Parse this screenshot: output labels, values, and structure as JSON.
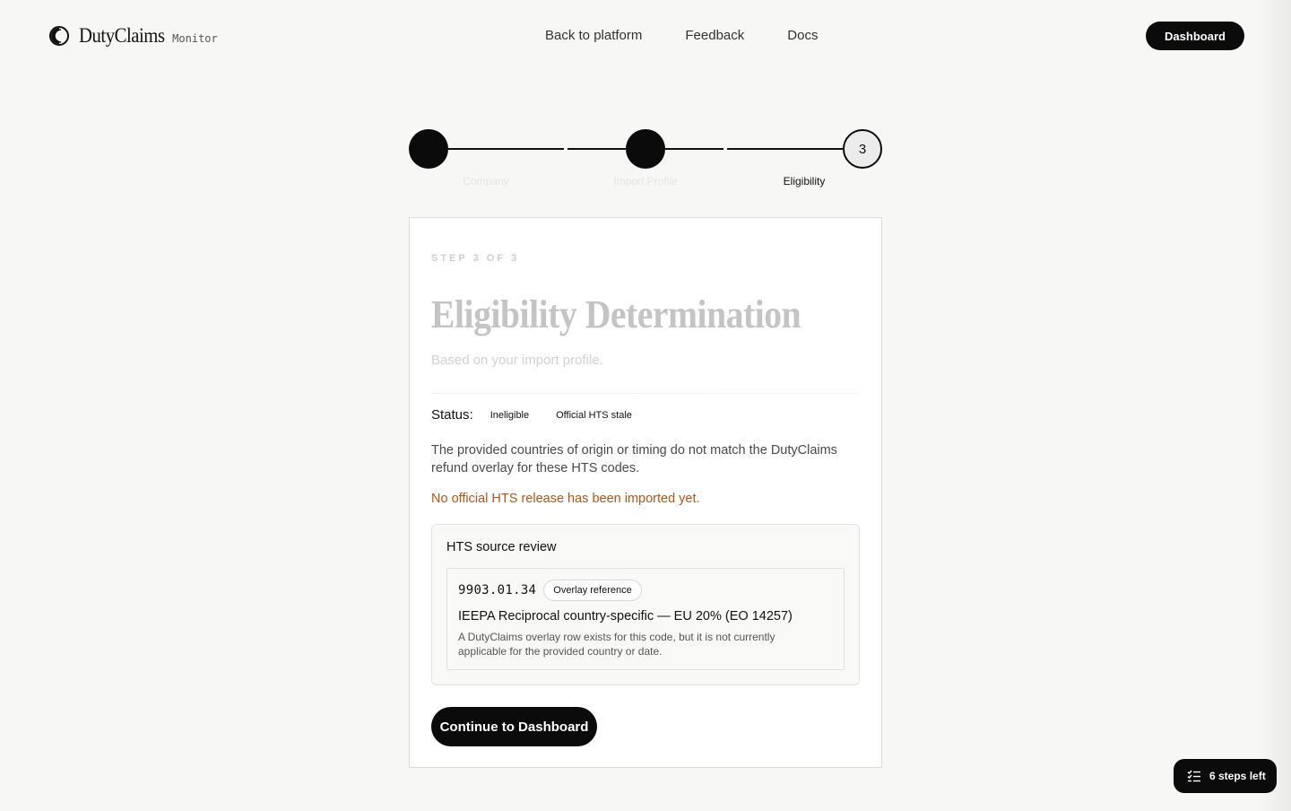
{
  "header": {
    "brand_name": "DutyClaims",
    "brand_sub": "Monitor",
    "nav": [
      {
        "label": "Back to platform"
      },
      {
        "label": "Feedback"
      },
      {
        "label": "Docs"
      }
    ],
    "dashboard_label": "Dashboard"
  },
  "stepper": {
    "steps": [
      {
        "number": "",
        "label": "Company",
        "state": "done"
      },
      {
        "number": "",
        "label": "Import Profile",
        "state": "done"
      },
      {
        "number": "3",
        "label": "Eligibility",
        "state": "current"
      }
    ]
  },
  "card": {
    "eyebrow": "STEP 3 OF 3",
    "title": "Eligibility Determination",
    "subtitle": "Based on your import profile.",
    "status_label": "Status:",
    "status_badges": [
      "Ineligible",
      "Official HTS stale"
    ],
    "description": "The provided countries of origin or timing do not match the DutyClaims refund overlay for these HTS codes.",
    "warning": "No official HTS release has been imported yet.",
    "review": {
      "title": "HTS source review",
      "items": [
        {
          "code": "9903.01.34",
          "tag": "Overlay reference",
          "title": "IEEPA Reciprocal country-specific — EU 20% (EO 14257)",
          "note": "A DutyClaims overlay row exists for this code, but it is not currently applicable for the provided country or date."
        }
      ]
    },
    "continue_label": "Continue to Dashboard"
  },
  "widget": {
    "label": "6 steps left",
    "icon": "checklist-icon"
  },
  "colors": {
    "background": "#f7f7f5",
    "primary": "#0b0b0b",
    "warning": "#b65415"
  }
}
